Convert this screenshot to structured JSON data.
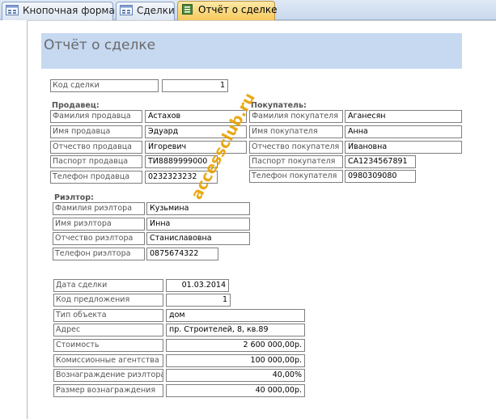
{
  "tabs": [
    {
      "label": "Кнопочная форма",
      "icon": "form-icon"
    },
    {
      "label": "Сделки",
      "icon": "form-icon"
    },
    {
      "label": "Отчёт о сделке",
      "icon": "report-icon",
      "active": true
    }
  ],
  "report": {
    "title": "Отчёт о сделке",
    "deal_code_label": "Код сделки",
    "deal_code_value": "1",
    "seller": {
      "section": "Продавец:",
      "fields": [
        {
          "label": "Фамилия продавца",
          "value": "Астахов"
        },
        {
          "label": "Имя продавца",
          "value": "Эдуард"
        },
        {
          "label": "Отчество продавца",
          "value": "Игоревич"
        },
        {
          "label": "Паспорт продавца",
          "value": "ТИ8889999000"
        },
        {
          "label": "Телефон продавца",
          "value": "0232323232"
        }
      ]
    },
    "buyer": {
      "section": "Покупатель:",
      "fields": [
        {
          "label": "Фамилия покупателя",
          "value": "Аганесян"
        },
        {
          "label": "Имя покупателя",
          "value": "Анна"
        },
        {
          "label": "Отчество покупателя",
          "value": "Ивановна"
        },
        {
          "label": "Паспорт покупателя",
          "value": "СА1234567891"
        },
        {
          "label": "Телефон покупателя",
          "value": "0980309080"
        }
      ]
    },
    "realtor": {
      "section": "Риэлтор:",
      "fields": [
        {
          "label": "Фамилия риэлтора",
          "value": "Кузьмина"
        },
        {
          "label": "Имя риэлтора",
          "value": "Инна"
        },
        {
          "label": "Отчество риэлтора",
          "value": "Станиславовна"
        },
        {
          "label": "Телефон риэлтора",
          "value": "0875674322"
        }
      ]
    },
    "deal": {
      "fields": [
        {
          "label": "Дата сделки",
          "value": "01.03.2014"
        },
        {
          "label": "Код предложения",
          "value": "1"
        },
        {
          "label": "Тип объекта",
          "value": "дом"
        },
        {
          "label": "Адрес",
          "value": "пр. Строителей, 8, кв.89"
        },
        {
          "label": "Стоимость",
          "value": "2 600 000,00р."
        },
        {
          "label": "Комиссионные агентства",
          "value": "100 000,00р."
        },
        {
          "label": "Вознаграждение риэлтора",
          "value": "40,00%"
        },
        {
          "label": "Размер вознаграждения",
          "value": "40 000,00р."
        }
      ]
    }
  },
  "watermark": "accessclub.ru",
  "colors": {
    "title_band": "#c6d9f1",
    "active_tab": "#f6c75b",
    "watermark": "#e6a100"
  }
}
